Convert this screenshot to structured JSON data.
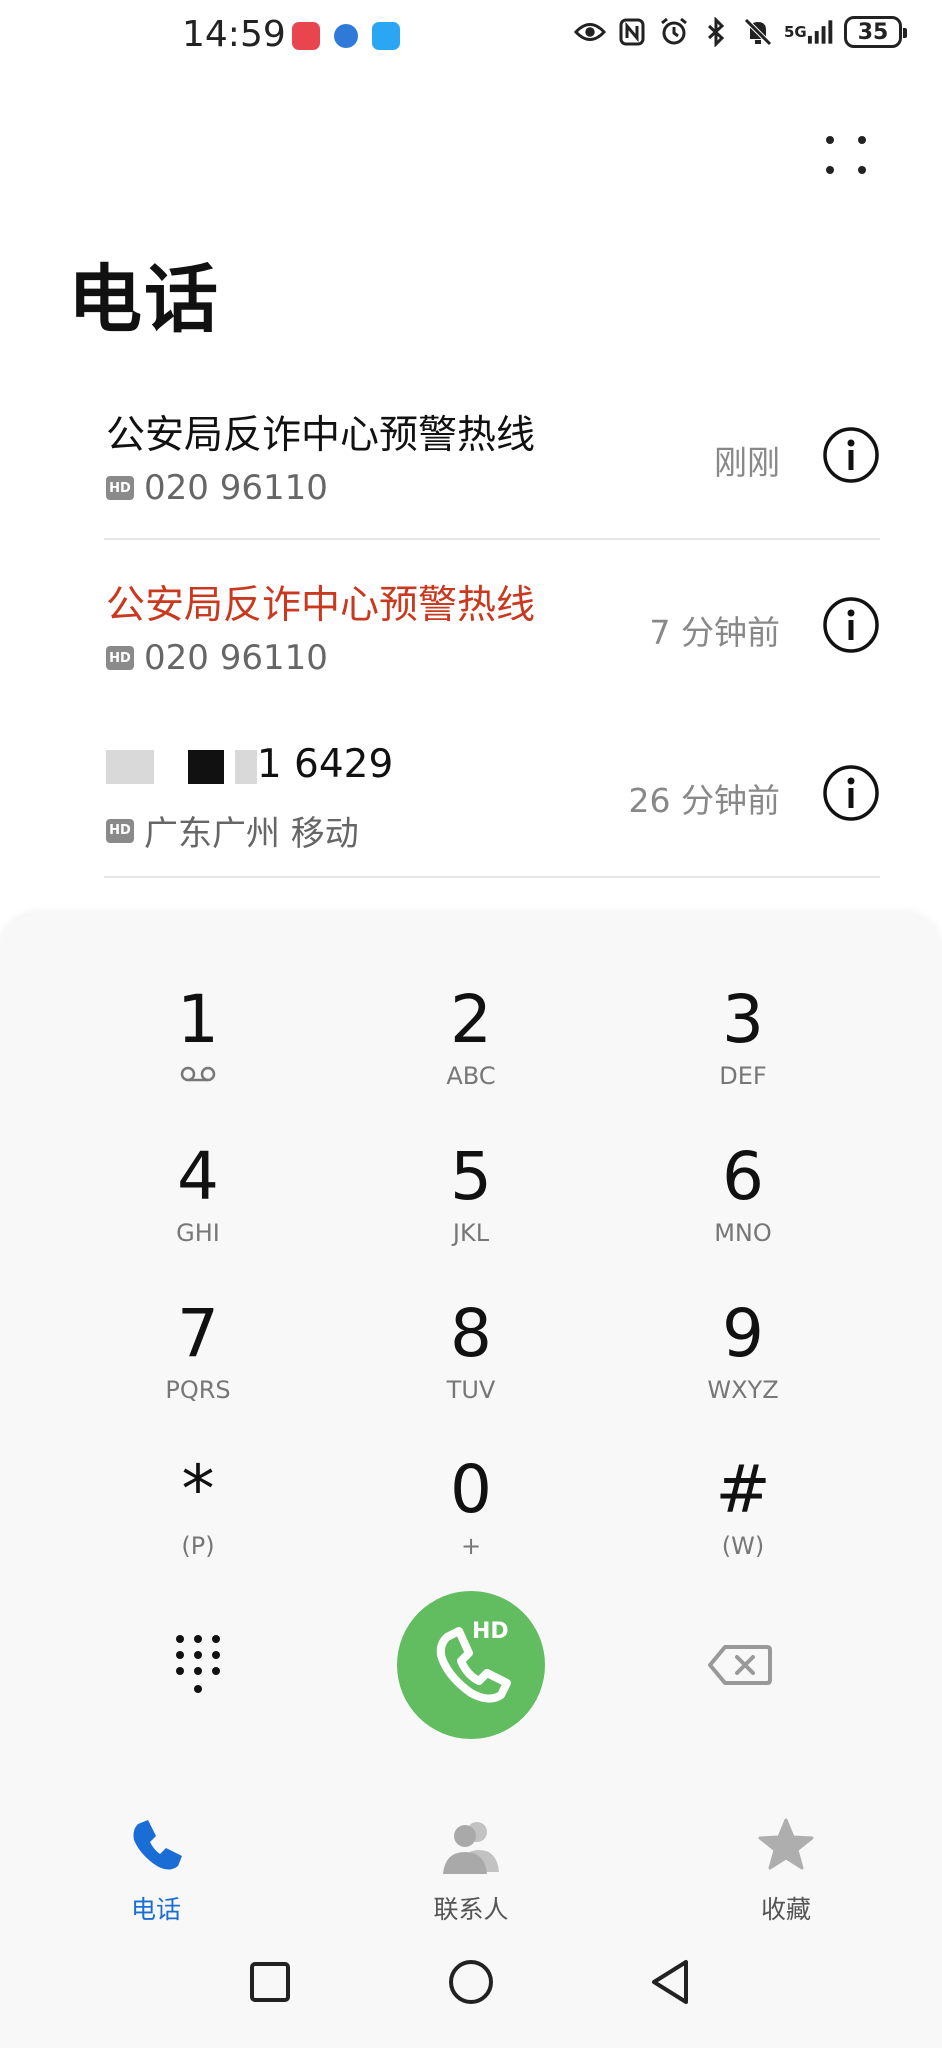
{
  "status_bar": {
    "time": "14:59",
    "network": "5G",
    "battery": "35"
  },
  "header": {
    "title": "电话",
    "more_icon": "more-dots-icon"
  },
  "call_log": [
    {
      "name": "公安局反诈中心预警热线",
      "number": "020 96110",
      "badge": "HD",
      "time": "刚刚",
      "missed": false
    },
    {
      "name": "公安局反诈中心预警热线",
      "number": "020 96110",
      "badge": "HD",
      "time": "7 分钟前",
      "missed": true
    },
    {
      "name_visible": "1 6429",
      "number": "广东广州 移动",
      "badge": "HD",
      "time": "26 分钟前",
      "missed": false
    }
  ],
  "dialpad": {
    "keys": [
      {
        "digit": "1",
        "letters": ""
      },
      {
        "digit": "2",
        "letters": "ABC"
      },
      {
        "digit": "3",
        "letters": "DEF"
      },
      {
        "digit": "4",
        "letters": "GHI"
      },
      {
        "digit": "5",
        "letters": "JKL"
      },
      {
        "digit": "6",
        "letters": "MNO"
      },
      {
        "digit": "7",
        "letters": "PQRS"
      },
      {
        "digit": "8",
        "letters": "TUV"
      },
      {
        "digit": "9",
        "letters": "WXYZ"
      },
      {
        "digit": "*",
        "letters": "(P)"
      },
      {
        "digit": "0",
        "letters": "+"
      },
      {
        "digit": "#",
        "letters": "(W)"
      }
    ],
    "call_button_badge": "HD",
    "call_color": "#62bd61"
  },
  "tabs": [
    {
      "label": "电话",
      "icon": "phone-icon",
      "active": true
    },
    {
      "label": "联系人",
      "icon": "contacts-icon",
      "active": false
    },
    {
      "label": "收藏",
      "icon": "star-icon",
      "active": false
    }
  ],
  "colors": {
    "accent": "#1a6dd4",
    "missed": "#c8391f"
  }
}
